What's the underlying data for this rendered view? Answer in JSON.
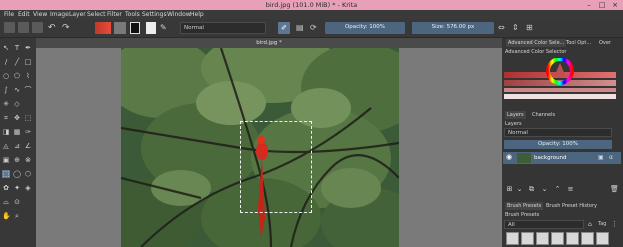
{
  "window": {
    "title": "bird.jpg (101.0 MiB) * - Krita"
  },
  "menu": [
    "File",
    "Edit",
    "View",
    "Image",
    "Layer",
    "Select",
    "Filter",
    "Tools",
    "Settings",
    "Window",
    "Help"
  ],
  "toolbar": {
    "blend_mode": "Normal",
    "opacity": "Opacity: 100%",
    "size": "Size: 576.00 px"
  },
  "document": {
    "tab_title": "bird.jpg *"
  },
  "docker_tabs": [
    "Advanced Color Sele...",
    "Tool Opt...",
    "Over"
  ],
  "color_selector": {
    "title": "Advanced Color Selector"
  },
  "layers": {
    "tabs": [
      "Layers",
      "Channels"
    ],
    "title": "Layers",
    "blend_mode": "Normal",
    "opacity": "Opacity: 100%",
    "items": [
      {
        "name": "background"
      }
    ]
  },
  "brush": {
    "tabs": [
      "Brush Presets",
      "Brush Preset History"
    ],
    "title": "Brush Presets",
    "filter": "All",
    "tag_label": "Tag"
  },
  "colors": {
    "titlebar": "#e8a0b8",
    "accent": "#4d6680",
    "panel": "#383838"
  }
}
